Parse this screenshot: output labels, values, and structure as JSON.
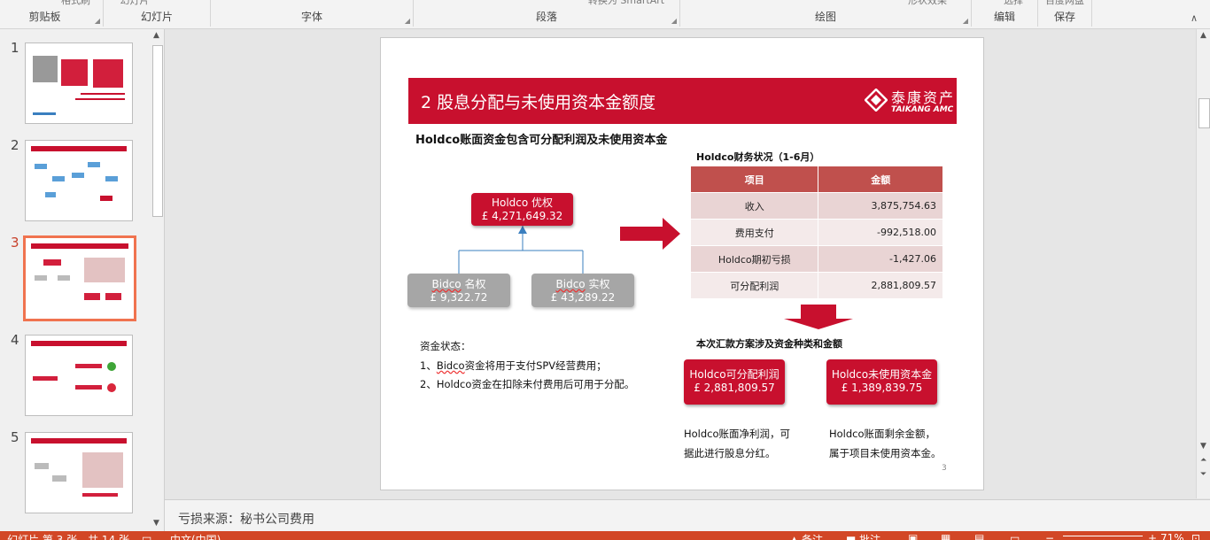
{
  "ribbon": {
    "groups": [
      {
        "label": "剪贴板",
        "cut_text": "格式刷"
      },
      {
        "label": "幻灯片",
        "cut_text": "幻灯片"
      },
      {
        "label": "字体",
        "cut_text": ""
      },
      {
        "label": "段落",
        "cut_text": "转换为 SmartArt"
      },
      {
        "label": "绘图",
        "cut_text": "形状效果"
      },
      {
        "label": "编辑",
        "cut_text": "选择"
      },
      {
        "label": "保存",
        "cut_text": "百度网盘"
      }
    ]
  },
  "thumbnails": [
    {
      "number": "1",
      "caption": "收购 Milton Gate 项目 股息分配与未使用资本金额度分配"
    },
    {
      "number": "2",
      "caption": ""
    },
    {
      "number": "3",
      "caption": ""
    },
    {
      "number": "4",
      "caption": ""
    },
    {
      "number": "5",
      "caption": ""
    }
  ],
  "slide": {
    "title": "2  股息分配与未使用资本金额度",
    "logo_cn": "泰康资产",
    "logo_en": "TAIKANG AMC",
    "subtitle": "Holdco账面资金包含可分配利润及未使用资本金",
    "holdco_box": {
      "name": "Holdco 优权",
      "amount": "£ 4,271,649.32"
    },
    "bidco_left": {
      "name_underlined": "Bidco",
      "name_rest": " 名权",
      "amount": "£ 9,322.72"
    },
    "bidco_right": {
      "name_underlined": "Bidco",
      "name_rest": " 实权",
      "amount": "£ 43,289.22"
    },
    "status_title": "资金状态：",
    "status_line1_prefix": "1、",
    "status_line1_under": "Bidco",
    "status_line1_rest": "资金将用于支付SPV经营费用；",
    "status_line2": "2、Holdco资金在扣除未付费用后可用于分配。",
    "fin_title": "Holdco财务状况（1-6月）",
    "fin_headers": [
      "项目",
      "金额"
    ],
    "fin_rows": [
      [
        "收入",
        "3,875,754.63"
      ],
      [
        "费用支付",
        "-992,518.00"
      ],
      [
        "Holdco期初亏损",
        "-1,427.06"
      ],
      [
        "可分配利润",
        "2,881,809.57"
      ]
    ],
    "fund_title": "本次汇款方案涉及资金种类和金额",
    "fund_left": {
      "name": "Holdco可分配利润",
      "amount": "£ 2,881,809.57"
    },
    "fund_right": {
      "name": "Holdco未使用资本金",
      "amount": "£ 1,389,839.75"
    },
    "note_left": [
      "Holdco账面净利润，可",
      "据此进行股息分红。"
    ],
    "note_right": [
      "Holdco账面剩余金额，",
      "属于项目未使用资本金。"
    ],
    "page_number": "3",
    "colors": {
      "brand_red": "#c8102e",
      "table_header": "#c0504d"
    }
  },
  "notes": {
    "text": "亏损来源：秘书公司费用"
  },
  "statusbar": {
    "slide_info": "幻灯片 第 3 张，共 14 张",
    "language": "中文(中国)",
    "notes_btn": "备注",
    "comments_btn": "批注",
    "zoom": "71%"
  }
}
